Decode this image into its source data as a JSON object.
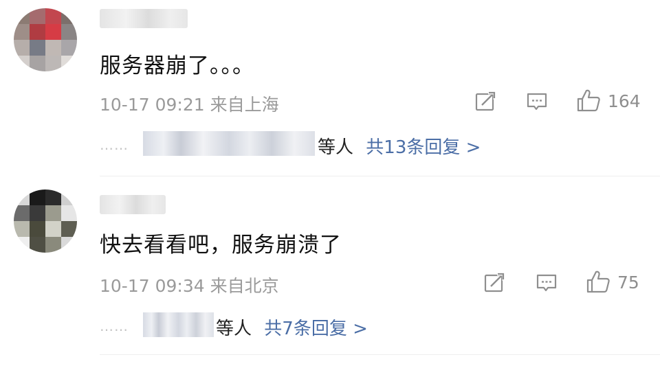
{
  "comments": [
    {
      "text": "服务器崩了。。。",
      "time": "10-17 09:21",
      "location": "来自上海",
      "likes": "164",
      "replies_dots": "……",
      "replies_suffix": "等人",
      "replies_link": "共13条回复 >",
      "avatar_colors": [
        "#8c7b73",
        "#a56b6e",
        "#c2474f",
        "#7c6f6b",
        "#9e8e88",
        "#b03c42",
        "#d63c45",
        "#8a8585",
        "#b6aeaa",
        "#777b86",
        "#c0b8b4",
        "#a9a6a9",
        "#d4cfcc",
        "#a7a3a3",
        "#bdb8b6",
        "#e0dcd9"
      ]
    },
    {
      "text": "快去看看吧，服务崩溃了",
      "time": "10-17 09:34",
      "location": "来自北京",
      "likes": "75",
      "replies_dots": "……",
      "replies_suffix": "等人",
      "replies_link": "共7条回复 >",
      "avatar_colors": [
        "#d8d8d8",
        "#1a1a1a",
        "#2b2b2b",
        "#cfcfcf",
        "#6b6b6b",
        "#3a3a3a",
        "#9b9b8e",
        "#e6e6e6",
        "#b9b9ae",
        "#4a4a3c",
        "#d2d2c8",
        "#5e5e52",
        "#efefef",
        "#4f4f44",
        "#8a8a7c",
        "#dadada"
      ]
    }
  ],
  "icons": {
    "repost": "repost-icon",
    "comment": "comment-icon",
    "like": "like-icon"
  },
  "colors": {
    "reply_link": "#4b6ea6",
    "meta": "#9a9a9a"
  }
}
